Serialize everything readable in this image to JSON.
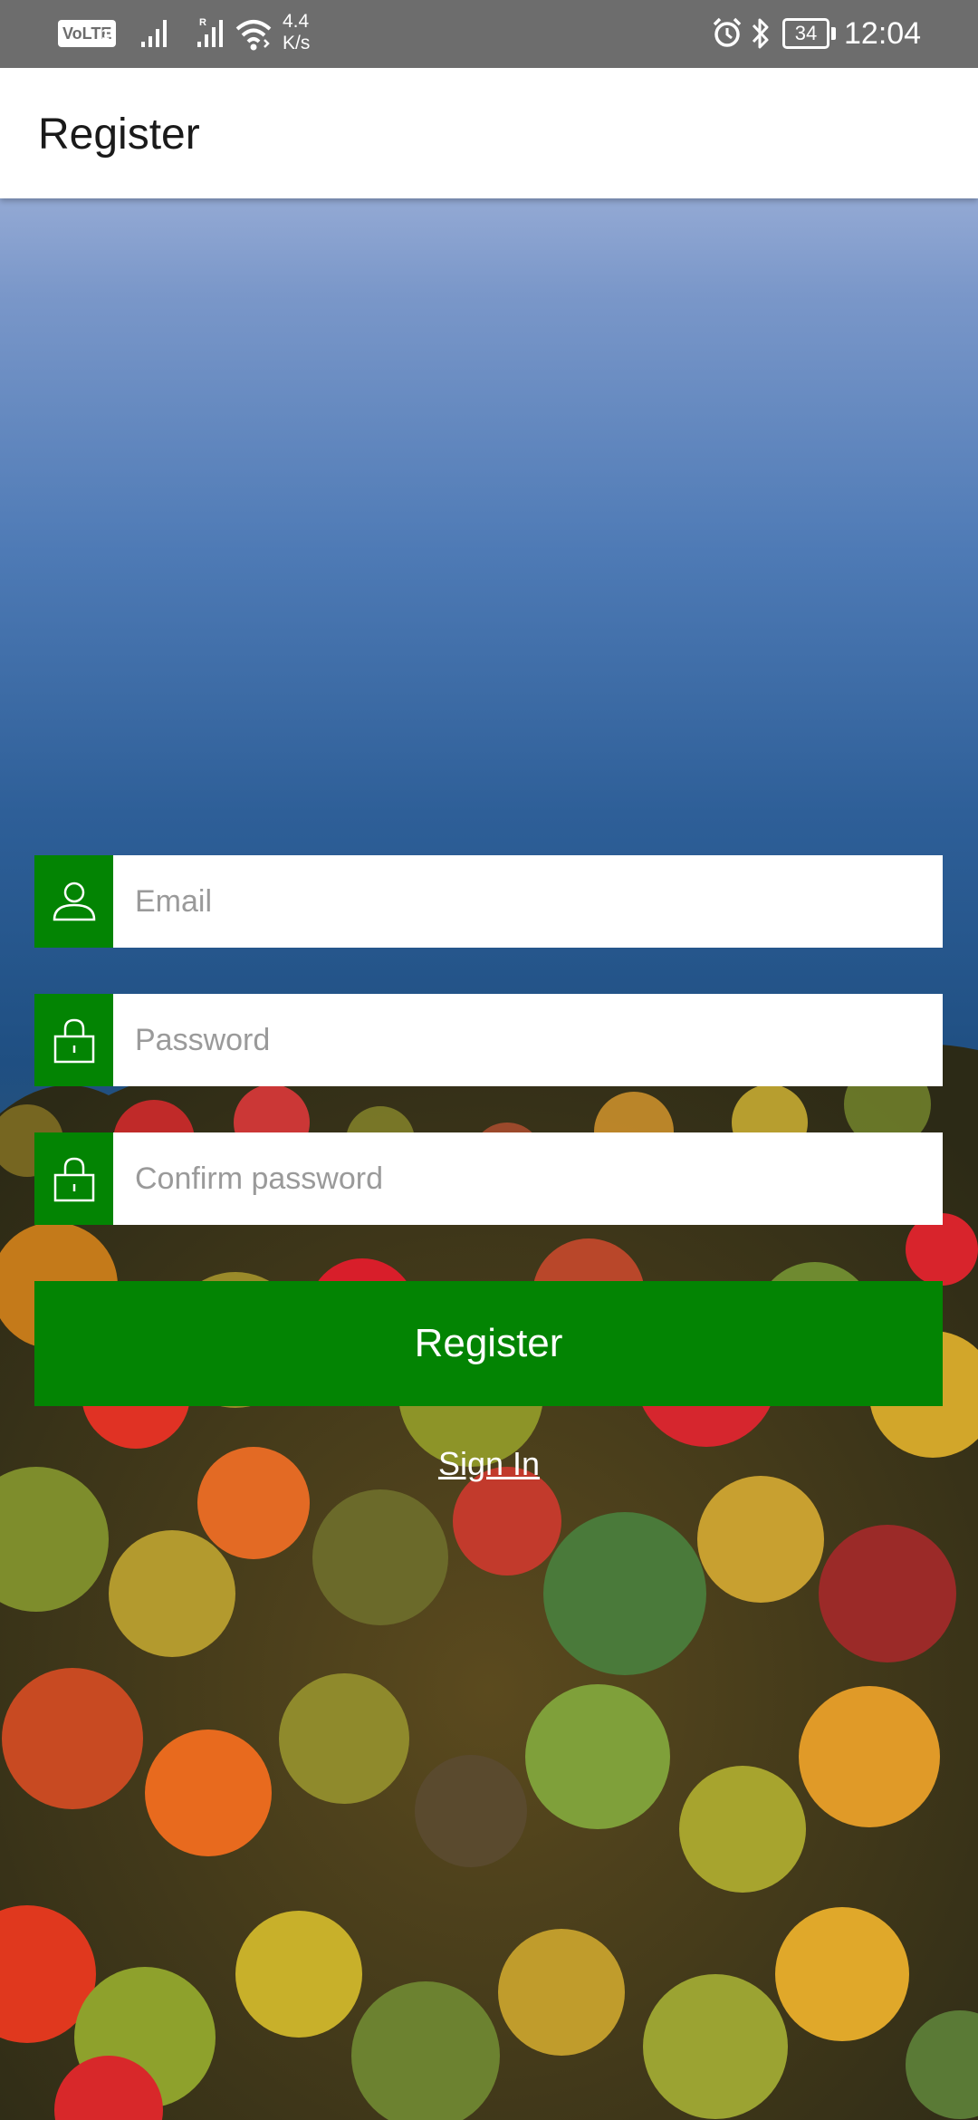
{
  "status_bar": {
    "volte": "VoLTE",
    "volte_sub": "1",
    "network_speed_value": "4.4",
    "network_speed_unit": "K/s",
    "battery_level": "34",
    "time": "12:04",
    "icons": [
      "volte-icon",
      "signal-icon",
      "roaming-signal-icon",
      "wifi-icon",
      "alarm-icon",
      "bluetooth-icon",
      "battery-icon"
    ]
  },
  "app_bar": {
    "title": "Register"
  },
  "form": {
    "email": {
      "placeholder": "Email",
      "value": "",
      "icon": "user-icon"
    },
    "password": {
      "placeholder": "Password",
      "value": "",
      "icon": "lock-icon"
    },
    "confirm_password": {
      "placeholder": "Confirm password",
      "value": "",
      "icon": "lock-icon"
    },
    "register_label": "Register",
    "sign_in_label": "Sign In"
  },
  "colors": {
    "accent_green": "#038403",
    "status_bar": "#6d6d6d",
    "app_bar": "#ffffff",
    "placeholder_text": "#9a9a9a",
    "water": "#1d4f7e"
  }
}
